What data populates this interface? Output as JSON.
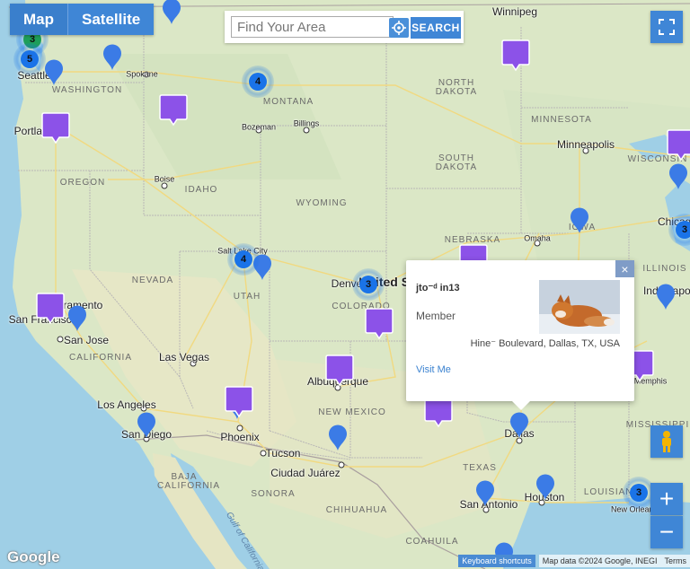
{
  "controls": {
    "map_label": "Map",
    "satellite_label": "Satellite",
    "search_placeholder": "Find Your Area",
    "search_button": "SEARCH",
    "zoom_in": "+",
    "zoom_out": "−"
  },
  "popup": {
    "name": "jto⁻ᵈ in13",
    "role": "Member",
    "address": "Hine⁻ Boulevard, Dallas, TX, USA",
    "visit_label": "Visit Me",
    "close": "×"
  },
  "footer": {
    "google": "Google",
    "shortcuts": "Keyboard shortcuts",
    "map_data": "Map data ©2024 Google, INEGI",
    "terms": "Terms"
  },
  "labels": {
    "states": [
      "WASHINGTON",
      "MONTANA",
      "NORTH DAKOTA",
      "MINNESOTA",
      "OREGON",
      "IDAHO",
      "SOUTH DAKOTA",
      "WISCONSIN",
      "WYOMING",
      "NEBRASKA",
      "IOWA",
      "NEVADA",
      "UTAH",
      "COLORADO",
      "ILLINOIS",
      "CALIFORNIA",
      "NEW MEXICO",
      "MISSISSIPPI",
      "TEXAS",
      "LOUISIANA",
      "BAJA CALIFORNIA",
      "SONORA",
      "CHIHUAHUA",
      "COAHUILA"
    ],
    "cities": [
      "Winnipeg",
      "Seattle",
      "Spokane",
      "Portland",
      "Bozeman",
      "Billings",
      "Minneapolis",
      "Boise",
      "Salt Lake City",
      "Denver",
      "Omaha",
      "Sacramento",
      "San Francisco",
      "San Jose",
      "Las Vegas",
      "Los Angeles",
      "San Diego",
      "Phoenix",
      "Tucson",
      "Albuquerque",
      "Ciudad Juárez",
      "Dallas",
      "San Antonio",
      "Houston",
      "New Orleans",
      "Memphis",
      "Chicago",
      "Indianapolis",
      "United States"
    ],
    "ocean": "Gulf of California"
  },
  "clusters": [
    "3",
    "5",
    "4",
    "4",
    "3",
    "3",
    "3"
  ],
  "colors": {
    "pin": "#3b7be6",
    "bubble": "#8c52e8",
    "control": "#3f86d6",
    "land": "#dfe9c9",
    "water": "#9fd0e8"
  }
}
